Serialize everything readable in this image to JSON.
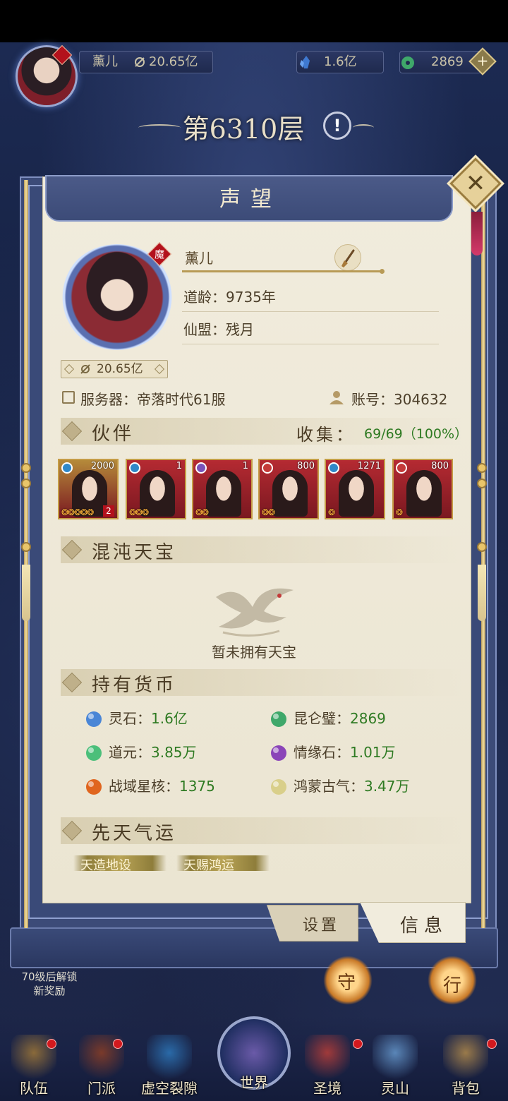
{
  "top_bar": {
    "player_name": "薰儿",
    "power": "20.65亿",
    "spirit_stone": "1.6亿",
    "jade": "2869",
    "add_symbol": "+"
  },
  "floor": {
    "title": "第6310层",
    "info_symbol": "!"
  },
  "panel": {
    "title": "声望",
    "close_symbol": "✕",
    "profile": {
      "badge": "魔",
      "name": "薰儿",
      "age_label": "道龄：",
      "age_value": "9735年",
      "guild_label": "仙盟：",
      "guild_value": "残月",
      "power": "20.65亿",
      "server_label": "服务器：",
      "server_value": "帝落时代61服",
      "account_label": "账号：",
      "account_value": "304632"
    },
    "partners": {
      "section_title": "伙伴",
      "collect_label": "收集：",
      "collect_value": "69/69（100%）",
      "cards": [
        {
          "level": "2000",
          "stars": "❂❂❂❂❂",
          "rank": "2",
          "bg": "#b58a3a",
          "elem": "#2f88c9"
        },
        {
          "level": "1",
          "stars": "❂❂❂",
          "rank": "",
          "bg": "#b52a32",
          "elem": "#2f88c9"
        },
        {
          "level": "1",
          "stars": "❂❂",
          "rank": "",
          "bg": "#b52a32",
          "elem": "#7a53b8"
        },
        {
          "level": "800",
          "stars": "❂❂",
          "rank": "",
          "bg": "#b52a32",
          "elem": "#c43a3a"
        },
        {
          "level": "1271",
          "stars": "❂",
          "rank": "",
          "bg": "#b52a32",
          "elem": "#2f88c9"
        },
        {
          "level": "800",
          "stars": "❂",
          "rank": "",
          "bg": "#b52a32",
          "elem": "#c43a3a"
        }
      ]
    },
    "treasure": {
      "section_title": "混沌天宝",
      "empty_text": "暂未拥有天宝"
    },
    "currency": {
      "section_title": "持有货币",
      "items": [
        {
          "label": "灵石：",
          "value": "1.6亿",
          "icon": "spirit-stone-icon",
          "color": "#4a86d6"
        },
        {
          "label": "昆仑璧：",
          "value": "2869",
          "icon": "kunlun-jade-icon",
          "color": "#3fa86a"
        },
        {
          "label": "道元：",
          "value": "3.85万",
          "icon": "dao-essence-icon",
          "color": "#4bbf7a"
        },
        {
          "label": "情缘石：",
          "value": "1.01万",
          "icon": "affinity-stone-icon",
          "color": "#8b45b8"
        },
        {
          "label": "战域星核：",
          "value": "1375",
          "icon": "star-core-icon",
          "color": "#e0651e"
        },
        {
          "label": "鸿蒙古气：",
          "value": "3.47万",
          "icon": "primordial-qi-icon",
          "color": "#d9cf8a"
        }
      ]
    },
    "fortune": {
      "section_title": "先天气运",
      "chips": [
        "天造地设",
        "天赐鸿运"
      ]
    },
    "tabs": {
      "settings": "设置",
      "info": "信息"
    }
  },
  "hud": {
    "unlock_text_1": "70级后解锁",
    "unlock_text_2": "新奖励",
    "orb_left_label": "守",
    "orb_right_label": "行"
  },
  "bottom_nav": [
    {
      "label": "队伍",
      "color": "#8a6a3a"
    },
    {
      "label": "门派",
      "color": "#7a3a2a"
    },
    {
      "label": "虚空裂隙",
      "color": "#2a6aa8"
    },
    {
      "label": "世界",
      "color": "#3b5aa0"
    },
    {
      "label": "圣境",
      "color": "#a03a3a"
    },
    {
      "label": "灵山",
      "color": "#5a86b8"
    },
    {
      "label": "背包",
      "color": "#9a7a4a"
    }
  ]
}
